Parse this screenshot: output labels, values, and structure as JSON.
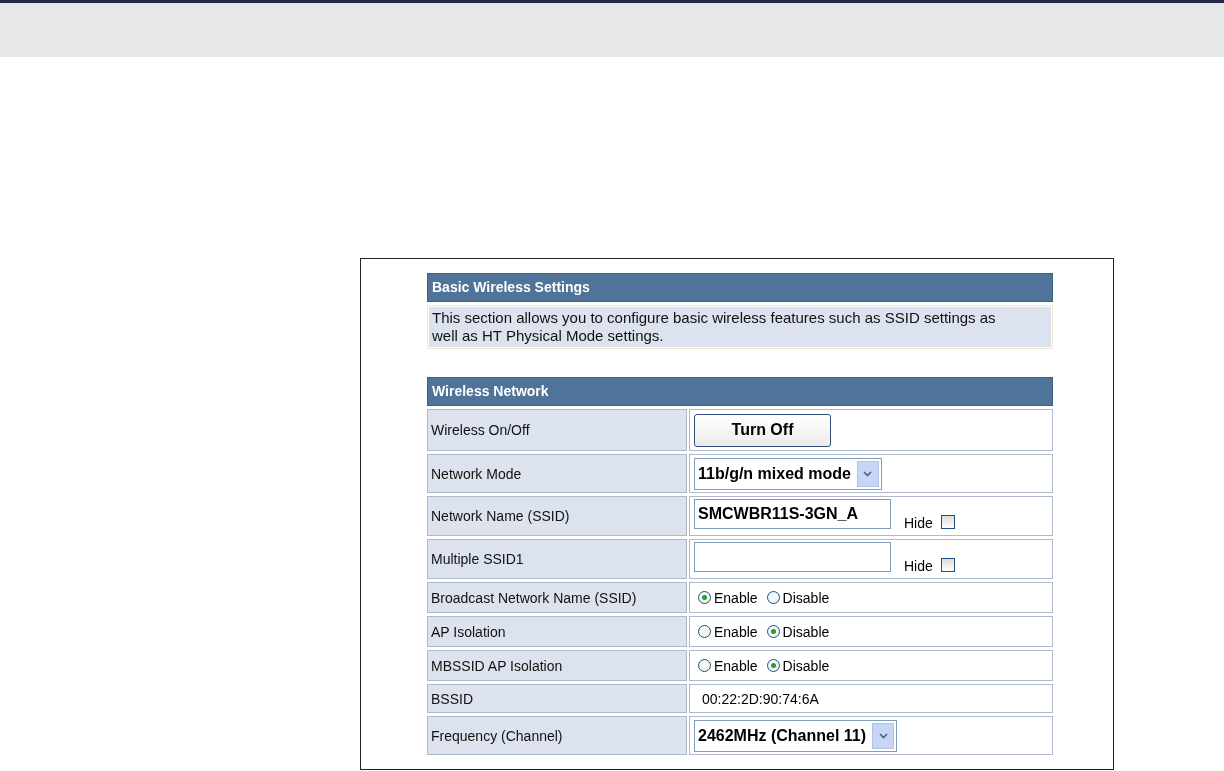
{
  "basic": {
    "title": "Basic Wireless Settings",
    "description": "This section allows you to configure basic wireless features such as SSID settings as well as HT Physical Mode settings."
  },
  "wireless_network": {
    "title": "Wireless Network",
    "rows": [
      {
        "kind": "button",
        "label": "Wireless On/Off",
        "button": "Turn Off"
      },
      {
        "kind": "select",
        "label": "Network Mode",
        "value": "11b/g/n mixed mode"
      },
      {
        "kind": "text",
        "label": "Network Name (SSID)",
        "value": "SMCWBR11S-3GN_A",
        "hide_label": "Hide",
        "hide_checked": false
      },
      {
        "kind": "text",
        "label": "Multiple SSID1",
        "hide_label": "Hide",
        "hide_checked": false
      },
      {
        "kind": "radio",
        "label": "Broadcast Network Name (SSID)",
        "options": [
          {
            "label": "Enable",
            "selected": true
          },
          {
            "label": "Disable",
            "selected": false
          }
        ]
      },
      {
        "kind": "radio",
        "label": "AP Isolation",
        "options": [
          {
            "label": "Enable",
            "selected": false
          },
          {
            "label": "Disable",
            "selected": true
          }
        ]
      },
      {
        "kind": "radio",
        "label": "MBSSID AP Isolation",
        "options": [
          {
            "label": "Enable",
            "selected": false
          },
          {
            "label": "Disable",
            "selected": true
          }
        ]
      },
      {
        "kind": "static",
        "label": "BSSID",
        "value": "00:22:2D:90:74:6A"
      },
      {
        "kind": "select",
        "label": "Frequency (Channel)",
        "value": "2462MHz (Channel 11)"
      }
    ]
  }
}
